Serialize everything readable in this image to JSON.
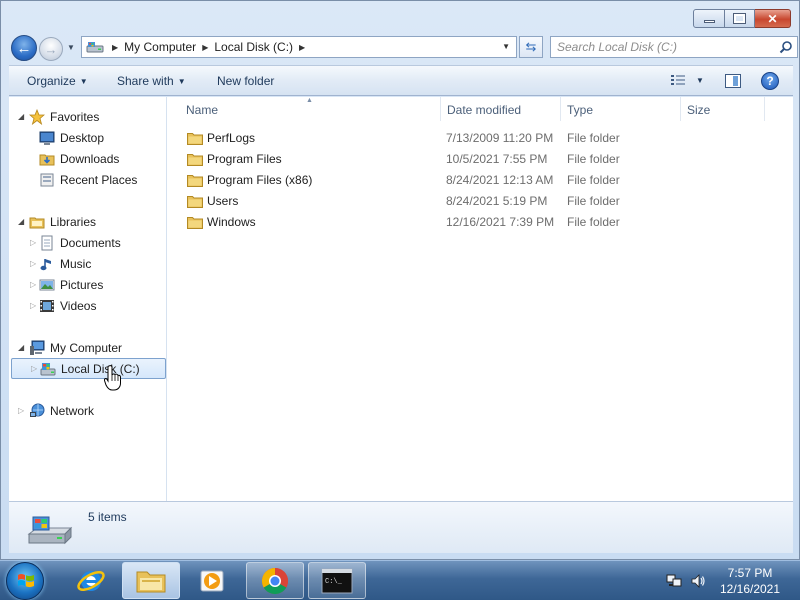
{
  "address_bar": {
    "crumbs": [
      "My Computer",
      "Local Disk (C:)"
    ]
  },
  "search": {
    "placeholder": "Search Local Disk (C:)"
  },
  "command_bar": {
    "organize": "Organize",
    "share_with": "Share with",
    "new_folder": "New folder",
    "help": "?"
  },
  "nav_tree": {
    "favorites": "Favorites",
    "desktop": "Desktop",
    "downloads": "Downloads",
    "recent_places": "Recent Places",
    "libraries": "Libraries",
    "documents": "Documents",
    "music": "Music",
    "pictures": "Pictures",
    "videos": "Videos",
    "my_computer": "My Computer",
    "local_disk": "Local Disk (C:)",
    "network": "Network"
  },
  "columns": {
    "name": "Name",
    "date_modified": "Date modified",
    "type": "Type",
    "size": "Size"
  },
  "files": [
    {
      "name": "PerfLogs",
      "date": "7/13/2009 11:20 PM",
      "type": "File folder"
    },
    {
      "name": "Program Files",
      "date": "10/5/2021 7:55 PM",
      "type": "File folder"
    },
    {
      "name": "Program Files (x86)",
      "date": "8/24/2021 12:13 AM",
      "type": "File folder"
    },
    {
      "name": "Users",
      "date": "8/24/2021 5:19 PM",
      "type": "File folder"
    },
    {
      "name": "Windows",
      "date": "12/16/2021 7:39 PM",
      "type": "File folder"
    }
  ],
  "details": {
    "item_count": "5 items"
  },
  "taskbar": {
    "time": "7:57 PM",
    "date": "12/16/2021"
  },
  "colors": {
    "accent": "#2b6cc5",
    "selection": "#d5e7fb",
    "folder": "#e8c15a"
  }
}
